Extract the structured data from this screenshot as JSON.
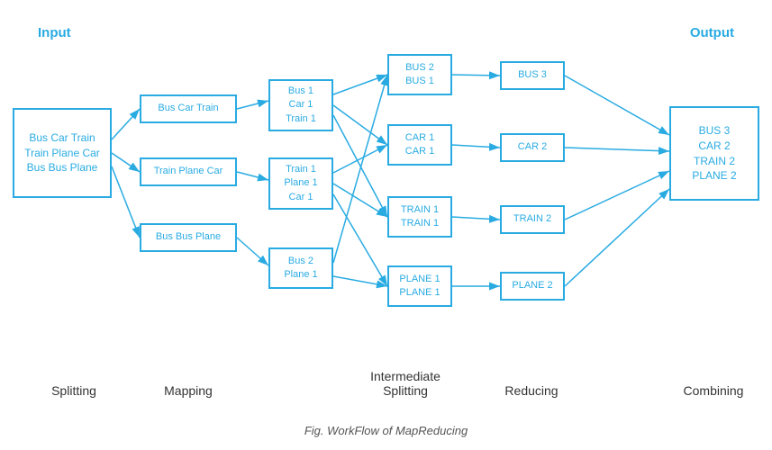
{
  "labels": {
    "input": "Input",
    "output": "Output",
    "splitting": "Splitting",
    "mapping": "Mapping",
    "intermediate_splitting": "Intermediate\nSplitting",
    "reducing": "Reducing",
    "combining": "Combining",
    "figure": "Fig. WorkFlow of MapReducing"
  },
  "input_box": {
    "text": "Bus Car Train\nTrain Plane Car\nBus Bus Plane"
  },
  "split_boxes": [
    {
      "text": "Bus Car Train"
    },
    {
      "text": "Train Plane Car"
    },
    {
      "text": "Bus Bus Plane"
    }
  ],
  "map_boxes": [
    {
      "text": "Bus 1\nCar 1\nTrain 1"
    },
    {
      "text": "Train 1\nPlane 1\nCar 1"
    },
    {
      "text": "Bus 2\nPlane 1"
    }
  ],
  "inter_boxes": [
    {
      "text": "BUS 2\nBUS 1"
    },
    {
      "text": "CAR 1\nCAR 1"
    },
    {
      "text": "TRAIN 1\nTRAIN 1"
    },
    {
      "text": "PLANE 1\nPLANE 1"
    }
  ],
  "reduce_boxes": [
    {
      "text": "BUS 3"
    },
    {
      "text": "CAR 2"
    },
    {
      "text": "TRAIN 2"
    },
    {
      "text": "PLANE 2"
    }
  ],
  "output_box": {
    "text": "BUS 3\nCAR 2\nTRAIN 2\nPLANE 2"
  }
}
